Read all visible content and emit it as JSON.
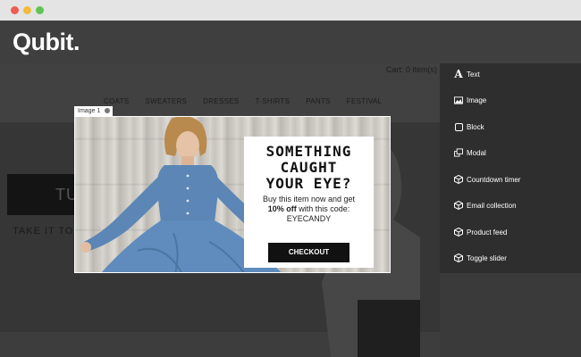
{
  "window": {
    "controls": [
      "close",
      "minimize",
      "maximize"
    ]
  },
  "app": {
    "logo": "Qubit."
  },
  "site": {
    "cart": "Cart: 0 item(s) -",
    "nav": [
      "COATS",
      "SWEATERS",
      "DRESSES",
      "T-SHIRTS",
      "PANTS",
      "FESTIVAL"
    ],
    "promo_partial": "TU",
    "promo_text": "TAKE IT TO T"
  },
  "modal": {
    "tag_label": "Image 1",
    "headline": [
      "SOMETHING",
      "CAUGHT",
      "YOUR EYE?"
    ],
    "body_line1": "Buy this item now and get",
    "body_bold": "10% off",
    "body_line2_rest": " with this code:",
    "code": "EYECANDY",
    "button": "CHECKOUT"
  },
  "menu": {
    "items": [
      {
        "label": "Text",
        "icon": "text-icon"
      },
      {
        "label": "Image",
        "icon": "image-icon"
      },
      {
        "label": "Block",
        "icon": "block-icon"
      },
      {
        "label": "Modal",
        "icon": "modal-icon"
      },
      {
        "label": "Countdown timer",
        "icon": "cube-icon"
      },
      {
        "label": "Email collection",
        "icon": "cube-icon"
      },
      {
        "label": "Product feed",
        "icon": "cube-icon"
      },
      {
        "label": "Toggle slider",
        "icon": "cube-icon"
      }
    ]
  }
}
